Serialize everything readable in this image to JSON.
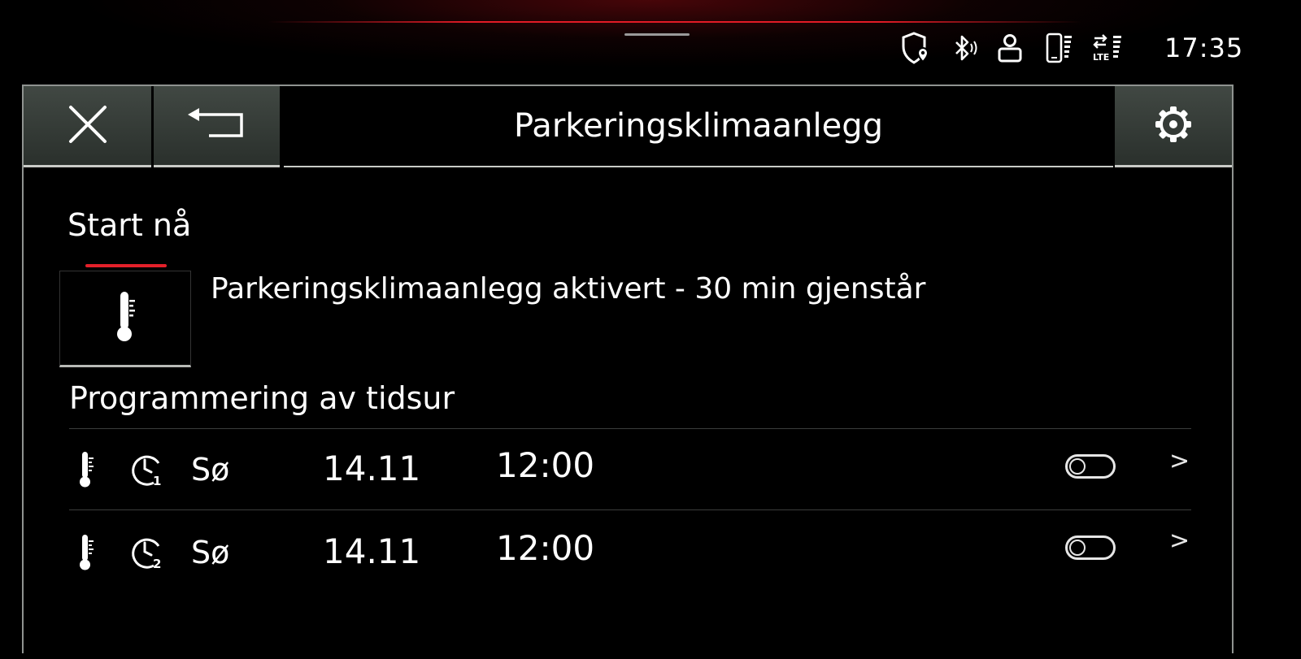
{
  "status_bar": {
    "icons": [
      "shield-location-icon",
      "bluetooth-icon",
      "user-profile-icon",
      "phone-signal-icon",
      "lte-data-icon"
    ],
    "time": "17:35"
  },
  "header": {
    "close_icon": "close-icon",
    "back_icon": "back-icon",
    "title": "Parkeringsklimaanlegg",
    "settings_icon": "gear-icon"
  },
  "start_now": {
    "title": "Start nå",
    "indicator_color": "#e3202a",
    "button_icon": "thermometer-icon",
    "status_message": "Parkeringsklimaanlegg aktivert - 30 min gjenstår"
  },
  "timers": {
    "title": "Programmering av tidsur",
    "rows": [
      {
        "icon": "thermometer-icon",
        "timer_icon": "timer-1-icon",
        "timer_number": "1",
        "day": "Sø",
        "date": "14.11",
        "time": "12:00",
        "enabled": false
      },
      {
        "icon": "thermometer-icon",
        "timer_icon": "timer-2-icon",
        "timer_number": "2",
        "day": "Sø",
        "date": "14.11",
        "time": "12:00",
        "enabled": false
      }
    ]
  },
  "colors": {
    "accent_red": "#e3202a",
    "header_button_bg": "#353b37",
    "panel_border": "#8f9390"
  }
}
